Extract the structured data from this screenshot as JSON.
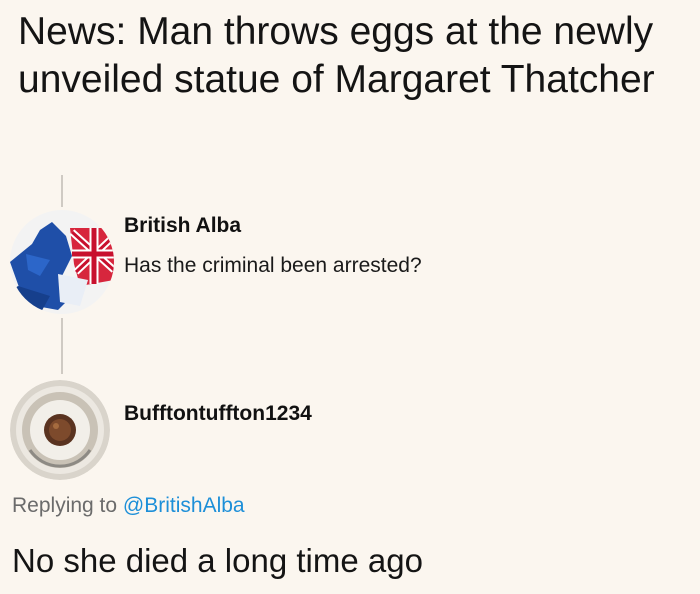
{
  "headline": "News: Man throws eggs at the newly unveiled statue of Margaret Thatcher",
  "comment": {
    "author": "British Alba",
    "text": "Has the criminal been arrested?",
    "avatar_icon": "union-flag-saltire-avatar-icon"
  },
  "reply": {
    "author": "Bufftontuffton1234",
    "avatar_icon": "coin-plate-avatar-icon",
    "replying_prefix": "Replying to",
    "replying_handle": "@BritishAlba",
    "text": "No she died a long time ago"
  },
  "colors": {
    "background": "#fbf6ef",
    "handle": "#1d8fd8",
    "muted": "#6b6b6b"
  }
}
